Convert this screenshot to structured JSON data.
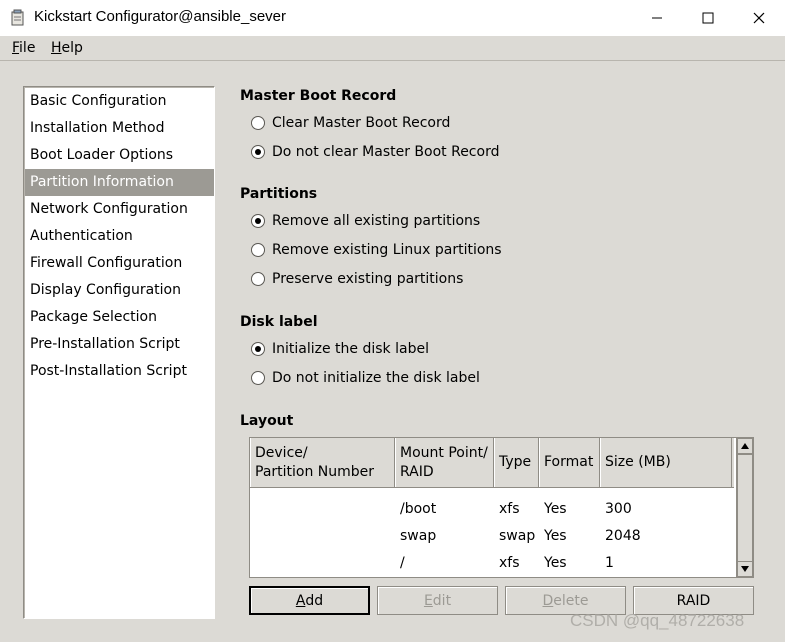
{
  "window": {
    "title": "Kickstart Configurator@ansible_sever",
    "icon": "kickstart-app-icon"
  },
  "menubar": {
    "items": [
      {
        "label": "File",
        "mnemonic": "F",
        "rest": "ile"
      },
      {
        "label": "Help",
        "mnemonic": "H",
        "rest": "elp"
      }
    ]
  },
  "sidebar": {
    "items": [
      {
        "label": "Basic Configuration",
        "selected": false
      },
      {
        "label": "Installation Method",
        "selected": false
      },
      {
        "label": "Boot Loader Options",
        "selected": false
      },
      {
        "label": "Partition Information",
        "selected": true
      },
      {
        "label": "Network Configuration",
        "selected": false
      },
      {
        "label": "Authentication",
        "selected": false
      },
      {
        "label": "Firewall Configuration",
        "selected": false
      },
      {
        "label": "Display Configuration",
        "selected": false
      },
      {
        "label": "Package Selection",
        "selected": false
      },
      {
        "label": "Pre-Installation Script",
        "selected": false
      },
      {
        "label": "Post-Installation Script",
        "selected": false
      }
    ]
  },
  "mbr": {
    "title": "Master Boot Record",
    "options": [
      {
        "label": "Clear Master Boot Record",
        "checked": false
      },
      {
        "label": "Do not clear Master Boot Record",
        "checked": true
      }
    ]
  },
  "partitions": {
    "title": "Partitions",
    "options": [
      {
        "label": "Remove all existing partitions",
        "checked": true
      },
      {
        "label": "Remove existing Linux partitions",
        "checked": false
      },
      {
        "label": "Preserve existing partitions",
        "checked": false
      }
    ]
  },
  "disklabel": {
    "title": "Disk label",
    "options": [
      {
        "label": "Initialize the disk label",
        "checked": true
      },
      {
        "label": "Do not initialize the disk label",
        "checked": false
      }
    ]
  },
  "layout": {
    "title": "Layout",
    "columns": [
      {
        "line1": "Device/",
        "line2": "Partition Number"
      },
      {
        "line1": "Mount Point/",
        "line2": "RAID"
      },
      {
        "line1": "Type",
        "line2": ""
      },
      {
        "line1": "Format",
        "line2": ""
      },
      {
        "line1": "Size (MB)",
        "line2": ""
      }
    ],
    "rows": [
      {
        "device": "",
        "mount": "/boot",
        "type": "xfs",
        "format": "Yes",
        "size": "300"
      },
      {
        "device": "",
        "mount": "swap",
        "type": "swap",
        "format": "Yes",
        "size": "2048"
      },
      {
        "device": "",
        "mount": "/",
        "type": "xfs",
        "format": "Yes",
        "size": "1"
      }
    ]
  },
  "buttons": {
    "add": {
      "mnemonic": "A",
      "rest": "dd"
    },
    "edit": {
      "mnemonic": "E",
      "rest": "dit"
    },
    "delete": {
      "mnemonic": "D",
      "rest": "elete"
    },
    "raid": {
      "label": "RAID"
    }
  },
  "watermark": "CSDN @qq_48722638"
}
